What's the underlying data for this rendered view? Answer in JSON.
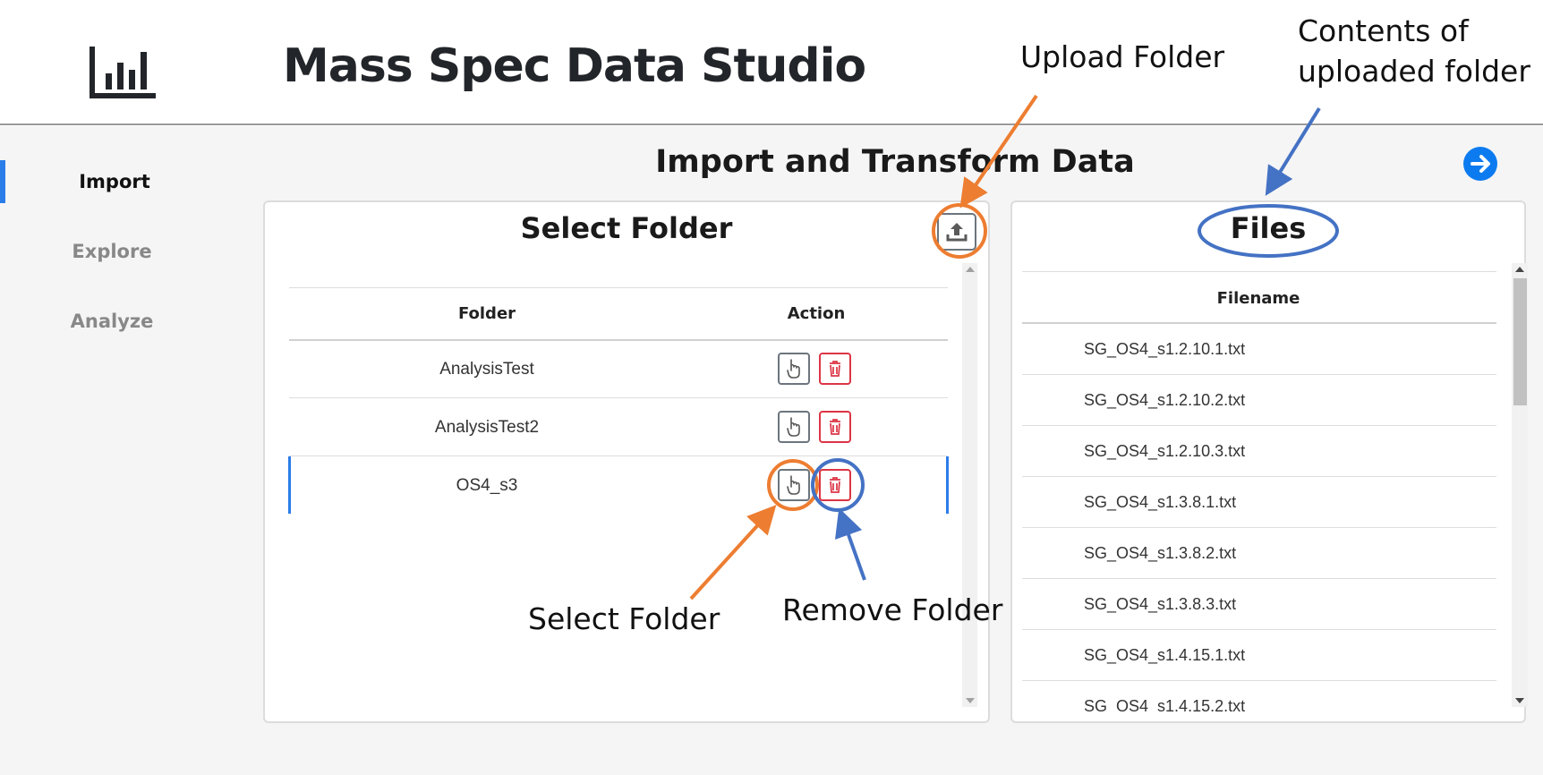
{
  "app": {
    "title": "Mass Spec Data Studio",
    "logo_icon": "bar-chart-icon"
  },
  "sidebar": {
    "items": [
      {
        "label": "Import",
        "active": true
      },
      {
        "label": "Explore",
        "active": false
      },
      {
        "label": "Analyze",
        "active": false
      }
    ]
  },
  "main": {
    "title": "Import and Transform Data",
    "next_icon": "arrow-right-circle-icon"
  },
  "folder_panel": {
    "title": "Select Folder",
    "upload_icon": "upload-icon",
    "columns": [
      "Folder",
      "Action"
    ],
    "rows": [
      {
        "folder": "AnalysisTest",
        "selected": false
      },
      {
        "folder": "AnalysisTest2",
        "selected": false
      },
      {
        "folder": "OS4_s3",
        "selected": true
      }
    ],
    "select_icon": "hand-pointer-icon",
    "remove_icon": "trash-icon"
  },
  "files_panel": {
    "title": "Files",
    "columns": [
      "Filename"
    ],
    "files": [
      "SG_OS4_s1.2.10.1.txt",
      "SG_OS4_s1.2.10.2.txt",
      "SG_OS4_s1.2.10.3.txt",
      "SG_OS4_s1.3.8.1.txt",
      "SG_OS4_s1.3.8.2.txt",
      "SG_OS4_s1.3.8.3.txt",
      "SG_OS4_s1.4.15.1.txt",
      "SG_OS4_s1.4.15.2.txt"
    ]
  },
  "annotations": {
    "upload_folder": "Upload Folder",
    "contents_line1": "Contents of",
    "contents_line2": "uploaded folder",
    "select_folder": "Select Folder",
    "remove_folder": "Remove Folder"
  },
  "colors": {
    "accent": "#2b7de9",
    "annotation_orange": "#ed7d31",
    "annotation_blue": "#4472c4",
    "danger": "#dc3545",
    "secondary": "#6c757d"
  }
}
